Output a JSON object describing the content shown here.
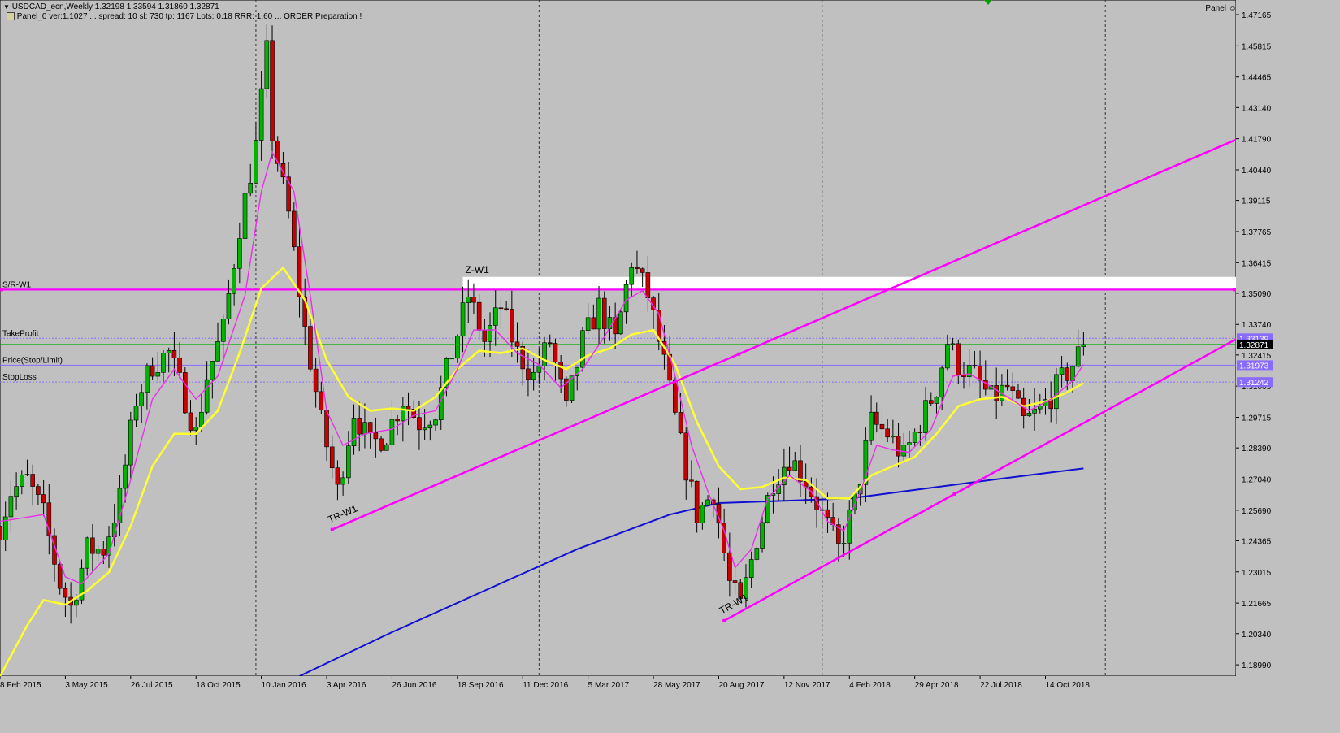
{
  "window": {
    "symbol_line": "USDCAD_ecn,Weekly 1.32198 1.33594 1.31860 1.32871",
    "panel_line": "Panel_0 ver:1.1027 ... spread: 10   sl: 730   tp: 1167   Lots: 0.18   RRR: 1.60   ... ORDER Preparation !",
    "panel_button": "Panel"
  },
  "chart_data": {
    "type": "candlestick",
    "symbol": "USDCAD_ecn",
    "timeframe": "Weekly",
    "ohlc_header": {
      "open": 1.32198,
      "high": 1.33594,
      "low": 1.3186,
      "close": 1.32871
    },
    "ylim": [
      1.185,
      1.478
    ],
    "xlim": [
      "2015-02-08",
      "2019-06-16"
    ],
    "y_ticks": [
      "1.47165",
      "1.45815",
      "1.44465",
      "1.43140",
      "1.41790",
      "1.40440",
      "1.39115",
      "1.37765",
      "1.36415",
      "1.35090",
      "1.33740",
      "1.32415",
      "1.31065",
      "1.29715",
      "1.28390",
      "1.27040",
      "1.25690",
      "1.24365",
      "1.23015",
      "1.21665",
      "1.20340",
      "1.18990"
    ],
    "x_ticks": [
      {
        "label": "8 Feb 2015",
        "date": "2015-02-08"
      },
      {
        "label": "3 May 2015",
        "date": "2015-05-03"
      },
      {
        "label": "26 Jul 2015",
        "date": "2015-07-26"
      },
      {
        "label": "18 Oct 2015",
        "date": "2015-10-18"
      },
      {
        "label": "10 Jan 2016",
        "date": "2016-01-10"
      },
      {
        "label": "3 Apr 2016",
        "date": "2016-04-03"
      },
      {
        "label": "26 Jun 2016",
        "date": "2016-06-26"
      },
      {
        "label": "18 Sep 2016",
        "date": "2016-09-18"
      },
      {
        "label": "11 Dec 2016",
        "date": "2016-12-11"
      },
      {
        "label": "5 Mar 2017",
        "date": "2017-03-05"
      },
      {
        "label": "28 May 2017",
        "date": "2017-05-28"
      },
      {
        "label": "20 Aug 2017",
        "date": "2017-08-20"
      },
      {
        "label": "12 Nov 2017",
        "date": "2017-11-12"
      },
      {
        "label": "4 Feb 2018",
        "date": "2018-02-04"
      },
      {
        "label": "29 Apr 2018",
        "date": "2018-04-29"
      },
      {
        "label": "22 Jul 2018",
        "date": "2018-07-22"
      },
      {
        "label": "14 Oct 2018",
        "date": "2018-10-14"
      }
    ],
    "period_separators": [
      "2016-01-03",
      "2017-01-01",
      "2017-12-31",
      "2018-12-30"
    ],
    "close_path": [
      [
        "2015-02-08",
        1.25
      ],
      [
        "2015-02-22",
        1.265
      ],
      [
        "2015-03-15",
        1.27
      ],
      [
        "2015-04-05",
        1.255
      ],
      [
        "2015-04-26",
        1.225
      ],
      [
        "2015-05-10",
        1.215
      ],
      [
        "2015-05-31",
        1.24
      ],
      [
        "2015-06-21",
        1.24
      ],
      [
        "2015-07-12",
        1.262
      ],
      [
        "2015-08-02",
        1.305
      ],
      [
        "2015-08-23",
        1.32
      ],
      [
        "2015-09-13",
        1.325
      ],
      [
        "2015-10-04",
        1.305
      ],
      [
        "2015-10-18",
        1.29
      ],
      [
        "2015-11-01",
        1.315
      ],
      [
        "2015-11-22",
        1.335
      ],
      [
        "2015-12-13",
        1.38
      ],
      [
        "2016-01-03",
        1.415
      ],
      [
        "2016-01-17",
        1.455
      ],
      [
        "2016-01-24",
        1.42
      ],
      [
        "2016-02-14",
        1.385
      ],
      [
        "2016-03-06",
        1.335
      ],
      [
        "2016-03-27",
        1.295
      ],
      [
        "2016-04-17",
        1.265
      ],
      [
        "2016-05-08",
        1.3
      ],
      [
        "2016-05-29",
        1.285
      ],
      [
        "2016-06-19",
        1.29
      ],
      [
        "2016-07-10",
        1.305
      ],
      [
        "2016-07-31",
        1.295
      ],
      [
        "2016-08-21",
        1.3
      ],
      [
        "2016-09-11",
        1.325
      ],
      [
        "2016-10-02",
        1.35
      ],
      [
        "2016-10-23",
        1.33
      ],
      [
        "2016-11-13",
        1.345
      ],
      [
        "2016-12-04",
        1.325
      ],
      [
        "2016-12-25",
        1.315
      ],
      [
        "2017-01-15",
        1.33
      ],
      [
        "2017-02-05",
        1.3
      ],
      [
        "2017-02-26",
        1.33
      ],
      [
        "2017-03-19",
        1.345
      ],
      [
        "2017-04-09",
        1.33
      ],
      [
        "2017-04-30",
        1.365
      ],
      [
        "2017-05-21",
        1.35
      ],
      [
        "2017-06-11",
        1.32
      ],
      [
        "2017-07-02",
        1.285
      ],
      [
        "2017-07-23",
        1.255
      ],
      [
        "2017-08-13",
        1.265
      ],
      [
        "2017-09-03",
        1.225
      ],
      [
        "2017-09-17",
        1.215
      ],
      [
        "2017-10-08",
        1.245
      ],
      [
        "2017-10-29",
        1.27
      ],
      [
        "2017-11-19",
        1.28
      ],
      [
        "2017-12-10",
        1.27
      ],
      [
        "2018-01-07",
        1.25
      ],
      [
        "2018-01-21",
        1.24
      ],
      [
        "2018-02-11",
        1.26
      ],
      [
        "2018-03-04",
        1.295
      ],
      [
        "2018-03-25",
        1.29
      ],
      [
        "2018-04-15",
        1.28
      ],
      [
        "2018-05-06",
        1.295
      ],
      [
        "2018-05-27",
        1.31
      ],
      [
        "2018-06-10",
        1.33
      ],
      [
        "2018-06-24",
        1.32
      ],
      [
        "2018-07-15",
        1.315
      ],
      [
        "2018-08-05",
        1.305
      ],
      [
        "2018-08-26",
        1.31
      ],
      [
        "2018-09-16",
        1.295
      ],
      [
        "2018-10-07",
        1.3
      ],
      [
        "2018-10-28",
        1.31
      ],
      [
        "2018-11-18",
        1.32
      ],
      [
        "2018-12-02",
        1.3287
      ]
    ],
    "ma_fast_pink": [
      [
        "2015-02-08",
        1.252
      ],
      [
        "2015-04-05",
        1.255
      ],
      [
        "2015-05-03",
        1.228
      ],
      [
        "2015-05-24",
        1.225
      ],
      [
        "2015-06-28",
        1.238
      ],
      [
        "2015-07-26",
        1.27
      ],
      [
        "2015-08-23",
        1.305
      ],
      [
        "2015-09-20",
        1.318
      ],
      [
        "2015-10-18",
        1.305
      ],
      [
        "2015-11-15",
        1.315
      ],
      [
        "2015-12-20",
        1.35
      ],
      [
        "2016-01-10",
        1.395
      ],
      [
        "2016-01-24",
        1.412
      ],
      [
        "2016-02-21",
        1.395
      ],
      [
        "2016-03-13",
        1.35
      ],
      [
        "2016-04-03",
        1.3
      ],
      [
        "2016-04-24",
        1.285
      ],
      [
        "2016-05-22",
        1.29
      ],
      [
        "2016-06-26",
        1.292
      ],
      [
        "2016-07-24",
        1.298
      ],
      [
        "2016-08-21",
        1.3
      ],
      [
        "2016-09-18",
        1.318
      ],
      [
        "2016-10-09",
        1.335
      ],
      [
        "2016-11-06",
        1.335
      ],
      [
        "2016-12-04",
        1.325
      ],
      [
        "2017-01-01",
        1.32
      ],
      [
        "2017-01-29",
        1.31
      ],
      [
        "2017-02-26",
        1.318
      ],
      [
        "2017-03-26",
        1.332
      ],
      [
        "2017-04-23",
        1.348
      ],
      [
        "2017-05-14",
        1.352
      ],
      [
        "2017-06-04",
        1.342
      ],
      [
        "2017-06-25",
        1.315
      ],
      [
        "2017-07-16",
        1.285
      ],
      [
        "2017-08-06",
        1.265
      ],
      [
        "2017-08-27",
        1.248
      ],
      [
        "2017-09-10",
        1.232
      ],
      [
        "2017-10-01",
        1.24
      ],
      [
        "2017-10-22",
        1.262
      ],
      [
        "2017-11-19",
        1.272
      ],
      [
        "2017-12-17",
        1.265
      ],
      [
        "2018-01-07",
        1.252
      ],
      [
        "2018-01-28",
        1.248
      ],
      [
        "2018-02-18",
        1.265
      ],
      [
        "2018-03-11",
        1.285
      ],
      [
        "2018-04-01",
        1.283
      ],
      [
        "2018-04-22",
        1.282
      ],
      [
        "2018-05-20",
        1.292
      ],
      [
        "2018-06-17",
        1.315
      ],
      [
        "2018-07-08",
        1.316
      ],
      [
        "2018-07-29",
        1.312
      ],
      [
        "2018-08-26",
        1.306
      ],
      [
        "2018-09-23",
        1.3
      ],
      [
        "2018-10-21",
        1.305
      ],
      [
        "2018-11-18",
        1.313
      ],
      [
        "2018-12-02",
        1.32
      ]
    ],
    "ma_mid_yellow": [
      [
        "2015-02-08",
        1.185
      ],
      [
        "2015-03-15",
        1.207
      ],
      [
        "2015-04-05",
        1.218
      ],
      [
        "2015-05-03",
        1.216
      ],
      [
        "2015-05-31",
        1.222
      ],
      [
        "2015-06-28",
        1.23
      ],
      [
        "2015-07-26",
        1.25
      ],
      [
        "2015-08-23",
        1.276
      ],
      [
        "2015-09-20",
        1.29
      ],
      [
        "2015-10-18",
        1.29
      ],
      [
        "2015-11-15",
        1.3
      ],
      [
        "2015-12-13",
        1.325
      ],
      [
        "2016-01-10",
        1.353
      ],
      [
        "2016-02-07",
        1.362
      ],
      [
        "2016-03-06",
        1.348
      ],
      [
        "2016-04-03",
        1.322
      ],
      [
        "2016-05-01",
        1.306
      ],
      [
        "2016-05-29",
        1.3
      ],
      [
        "2016-06-26",
        1.301
      ],
      [
        "2016-07-24",
        1.3
      ],
      [
        "2016-08-21",
        1.306
      ],
      [
        "2016-09-18",
        1.318
      ],
      [
        "2016-10-16",
        1.326
      ],
      [
        "2016-11-13",
        1.325
      ],
      [
        "2016-12-11",
        1.327
      ],
      [
        "2017-01-08",
        1.322
      ],
      [
        "2017-02-05",
        1.318
      ],
      [
        "2017-03-05",
        1.324
      ],
      [
        "2017-04-02",
        1.327
      ],
      [
        "2017-04-30",
        1.333
      ],
      [
        "2017-05-28",
        1.335
      ],
      [
        "2017-06-25",
        1.32
      ],
      [
        "2017-07-23",
        1.295
      ],
      [
        "2017-08-20",
        1.276
      ],
      [
        "2017-09-17",
        1.266
      ],
      [
        "2017-10-15",
        1.267
      ],
      [
        "2017-11-12",
        1.271
      ],
      [
        "2017-12-10",
        1.27
      ],
      [
        "2018-01-07",
        1.262
      ],
      [
        "2018-02-04",
        1.262
      ],
      [
        "2018-03-04",
        1.272
      ],
      [
        "2018-04-01",
        1.276
      ],
      [
        "2018-04-29",
        1.28
      ],
      [
        "2018-05-27",
        1.29
      ],
      [
        "2018-06-24",
        1.302
      ],
      [
        "2018-07-22",
        1.305
      ],
      [
        "2018-08-19",
        1.306
      ],
      [
        "2018-09-16",
        1.302
      ],
      [
        "2018-10-14",
        1.304
      ],
      [
        "2018-11-11",
        1.308
      ],
      [
        "2018-12-02",
        1.312
      ]
    ],
    "ma_slow_blue": [
      [
        "2016-02-28",
        1.185
      ],
      [
        "2016-06-26",
        1.204
      ],
      [
        "2016-10-23",
        1.222
      ],
      [
        "2017-02-19",
        1.24
      ],
      [
        "2017-06-18",
        1.255
      ],
      [
        "2017-08-20",
        1.26
      ],
      [
        "2017-11-12",
        1.261
      ],
      [
        "2018-02-04",
        1.262
      ],
      [
        "2018-05-06",
        1.266
      ],
      [
        "2018-08-05",
        1.27
      ],
      [
        "2018-12-02",
        1.275
      ]
    ],
    "levels": [
      {
        "name": "S/R-W1",
        "price": 1.3525,
        "color": "#ff00ff",
        "style": "solid"
      },
      {
        "name": "TakeProfit",
        "price": 1.33139,
        "color": "#8a6bff",
        "style": "dotted"
      },
      {
        "name": "Price(Stop/Limit)",
        "price": 1.31973,
        "color": "#8a6bff",
        "style": "solid"
      },
      {
        "name": "StopLoss",
        "price": 1.31242,
        "color": "#8a6bff",
        "style": "dotted"
      }
    ],
    "current_price": 1.32871,
    "right_badges": [
      "1.33139",
      "1.32871",
      "1.31973",
      "1.31242"
    ],
    "zone": {
      "name": "Z-W1",
      "start": "2016-09-25",
      "price_low": 1.3525,
      "price_high": 1.358
    },
    "trendlines": [
      {
        "name": "TR-W1",
        "start": [
          "2016-04-10",
          1.2485
        ],
        "end": [
          "2019-06-16",
          1.4175
        ]
      },
      {
        "name": "TR-W1",
        "start": [
          "2017-08-27",
          1.209
        ],
        "end": [
          "2019-06-16",
          1.331
        ]
      }
    ],
    "colors": {
      "background": "#c0c0c0",
      "bull": "#00b400",
      "bear": "#c80000",
      "ma_fast": "#e830e8",
      "ma_mid": "#ffff30",
      "ma_slow": "#1010d0",
      "sr": "#ff00ff",
      "trend": "#ff00ff",
      "order_lines": "#8a6bff",
      "take_profit_line": "#00aa00"
    }
  }
}
